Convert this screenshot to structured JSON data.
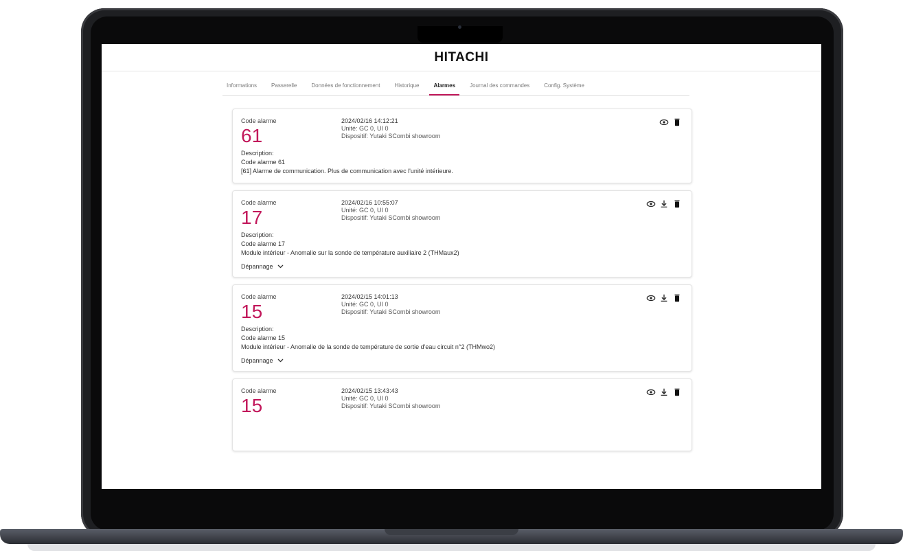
{
  "app": {
    "brand": "HITACHI"
  },
  "tabs": [
    {
      "label": "Informations"
    },
    {
      "label": "Passerelle"
    },
    {
      "label": "Données de fonctionnement"
    },
    {
      "label": "Historique"
    },
    {
      "label": "Alarmes",
      "active": true
    },
    {
      "label": "Journal des commandes"
    },
    {
      "label": "Config. Système"
    }
  ],
  "alarms": [
    {
      "label": "Code alarme",
      "code": "61",
      "datetime": "2024/02/16 14:12:21",
      "unit": "Unité: GC 0, UI 0",
      "device": "Dispositif: Yutaki SCombi showroom",
      "desc_label": "Description:",
      "desc_code": "Code alarme 61",
      "desc_text": "[61] Alarme de communication. Plus de communication avec l'unité intérieure."
    },
    {
      "label": "Code alarme",
      "code": "17",
      "datetime": "2024/02/16 10:55:07",
      "unit": "Unité: GC 0, UI 0",
      "device": "Dispositif: Yutaki SCombi showroom",
      "desc_label": "Description:",
      "desc_code": "Code alarme 17",
      "desc_text": "Module intérieur - Anomalie sur la sonde de température auxiliaire 2 (THMaux2)",
      "troubleshoot": "Dépannage"
    },
    {
      "label": "Code alarme",
      "code": "15",
      "datetime": "2024/02/15 14:01:13",
      "unit": "Unité: GC 0, UI 0",
      "device": "Dispositif: Yutaki SCombi showroom",
      "desc_label": "Description:",
      "desc_code": "Code alarme 15",
      "desc_text": "Module intérieur - Anomalie de la sonde de température de sortie d'eau circuit n°2 (THMwo2)",
      "troubleshoot": "Dépannage"
    },
    {
      "label": "Code alarme",
      "code": "15",
      "datetime": "2024/02/15 13:43:43",
      "unit": "Unité: GC 0, UI 0",
      "device": "Dispositif: Yutaki SCombi showroom"
    }
  ],
  "colors": {
    "accent": "#c2185b",
    "frame": "#1e1f22"
  },
  "icons": {
    "view": "eye-icon",
    "download": "download-icon",
    "delete": "trash-icon",
    "expand": "chevron-down-icon"
  }
}
